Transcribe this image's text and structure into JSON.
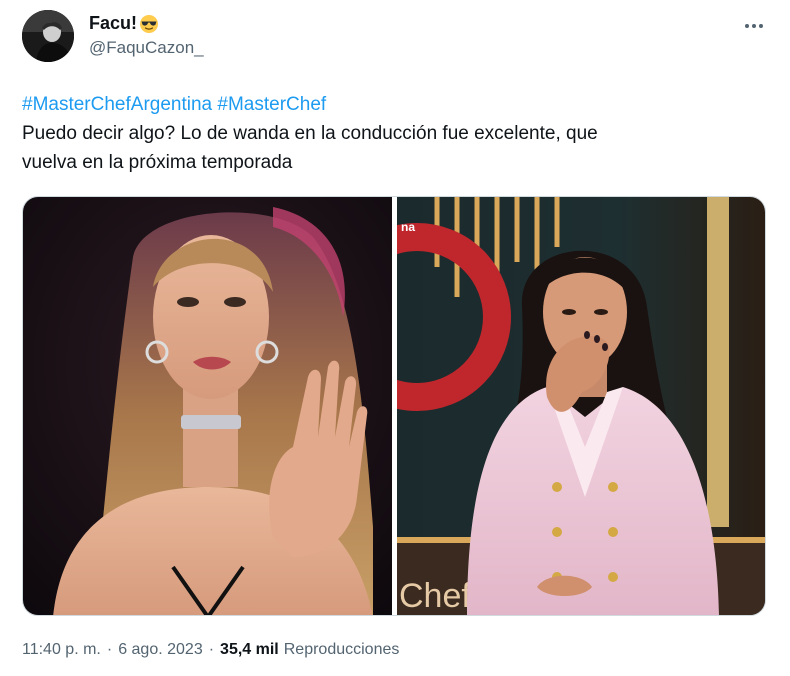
{
  "author": {
    "display_name": "Facu!",
    "handle": "@FaquCazon_",
    "emoji_icon": "sunglasses-emoji"
  },
  "tweet": {
    "hashtags": [
      "#MasterChefArgentina",
      "#MasterChef"
    ],
    "text_line1": "Puedo decir algo? Lo de wanda en la conducción fue excelente, que",
    "text_line2": "vuelva en la próxima temporada"
  },
  "media": {
    "count": 2,
    "right_photo_overlay_text": "Chef",
    "right_photo_edge_text": "na"
  },
  "meta": {
    "time": "11:40 p. m.",
    "separator": "·",
    "date": "6 ago. 2023",
    "views_count": "35,4 mil",
    "views_label": "Reproducciones"
  },
  "colors": {
    "link": "#1d9bf0",
    "text_primary": "#0f1419",
    "text_secondary": "#536471",
    "border": "#cfd9de"
  }
}
